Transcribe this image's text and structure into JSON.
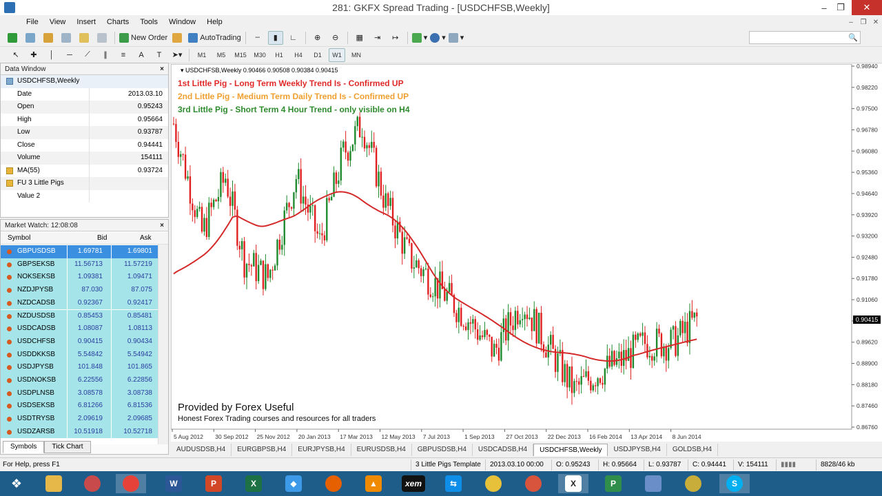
{
  "window": {
    "title": "281: GKFX Spread Trading - [USDCHFSB,Weekly]"
  },
  "menu": [
    "File",
    "View",
    "Insert",
    "Charts",
    "Tools",
    "Window",
    "Help"
  ],
  "toolbar": {
    "new_order": "New Order",
    "auto_trading": "AutoTrading",
    "timeframes": [
      "M1",
      "M5",
      "M15",
      "M30",
      "H1",
      "H4",
      "D1",
      "W1",
      "MN"
    ],
    "active_timeframe": "W1"
  },
  "data_window": {
    "title": "Data Window",
    "symbol": "USDCHFSB,Weekly",
    "rows": [
      {
        "label": "Date",
        "value": "2013.03.10"
      },
      {
        "label": "Open",
        "value": "0.95243"
      },
      {
        "label": "High",
        "value": "0.95664"
      },
      {
        "label": "Low",
        "value": "0.93787"
      },
      {
        "label": "Close",
        "value": "0.94441"
      },
      {
        "label": "Volume",
        "value": "154111"
      },
      {
        "label": "MA(55)",
        "value": "0.93724"
      },
      {
        "label": "FU 3 Little Pigs",
        "value": ""
      },
      {
        "label": "Value 2",
        "value": ""
      }
    ]
  },
  "market_watch": {
    "title": "Market Watch: 12:08:08",
    "columns": {
      "symbol": "Symbol",
      "bid": "Bid",
      "ask": "Ask"
    },
    "rows": [
      {
        "symbol": "GBPUSDSB",
        "bid": "1.69781",
        "ask": "1.69801"
      },
      {
        "symbol": "GBPSEKSB",
        "bid": "11.56713",
        "ask": "11.57219"
      },
      {
        "symbol": "NOKSEKSB",
        "bid": "1.09381",
        "ask": "1.09471"
      },
      {
        "symbol": "NZDJPYSB",
        "bid": "87.030",
        "ask": "87.075"
      },
      {
        "symbol": "NZDCADSB",
        "bid": "0.92367",
        "ask": "0.92417"
      },
      {
        "symbol": "NZDUSDSB",
        "bid": "0.85453",
        "ask": "0.85481"
      },
      {
        "symbol": "USDCADSB",
        "bid": "1.08087",
        "ask": "1.08113"
      },
      {
        "symbol": "USDCHFSB",
        "bid": "0.90415",
        "ask": "0.90434"
      },
      {
        "symbol": "USDDKKSB",
        "bid": "5.54842",
        "ask": "5.54942"
      },
      {
        "symbol": "USDJPYSB",
        "bid": "101.848",
        "ask": "101.865"
      },
      {
        "symbol": "USDNOKSB",
        "bid": "6.22556",
        "ask": "6.22856"
      },
      {
        "symbol": "USDPLNSB",
        "bid": "3.08578",
        "ask": "3.08738"
      },
      {
        "symbol": "USDSEKSB",
        "bid": "6.81266",
        "ask": "6.81536"
      },
      {
        "symbol": "USDTRYSB",
        "bid": "2.09619",
        "ask": "2.09685"
      },
      {
        "symbol": "USDZARSB",
        "bid": "10.51918",
        "ask": "10.52718"
      }
    ],
    "tabs": [
      "Symbols",
      "Tick Chart"
    ]
  },
  "chart": {
    "info": "USDCHFSB,Weekly  0.90466 0.90508 0.90384 0.90415",
    "pig1": "1st Little Pig - Long Term Weekly Trend Is - Confirmed UP",
    "pig2": "2nd Little Pig - Medium Term Daily Trend Is - Confirmed UP",
    "pig3": "3rd Little Pig - Short Term 4 Hour Trend - only visible on H4",
    "provided": "Provided by Forex Useful",
    "honest": "Honest Forex Trading courses and resources for all traders",
    "current_price": "0.90415",
    "price_ticks": [
      "0.98940",
      "0.98220",
      "0.97500",
      "0.96780",
      "0.96080",
      "0.95360",
      "0.94640",
      "0.93920",
      "0.93200",
      "0.92480",
      "0.91780",
      "0.91060",
      "0.90340",
      "0.89620",
      "0.88900",
      "0.88180",
      "0.87460",
      "0.86760"
    ],
    "date_ticks": [
      "5 Aug 2012",
      "30 Sep 2012",
      "25 Nov 2012",
      "20 Jan 2013",
      "17 Mar 2013",
      "12 May 2013",
      "7 Jul 2013",
      "1 Sep 2013",
      "27 Oct 2013",
      "22 Dec 2013",
      "16 Feb 2014",
      "13 Apr 2014",
      "8 Jun 2014"
    ],
    "colors": {
      "up": "#1f8a2e",
      "down": "#e02020",
      "ma": "#d42a2a",
      "pig1": "#e02a2a",
      "pig2": "#f0a030",
      "pig3": "#2e8b2e"
    }
  },
  "chart_tabs": [
    "AUDUSDSB,H4",
    "EURGBPSB,H4",
    "EURJPYSB,H4",
    "EURUSDSB,H4",
    "GBPUSDSB,H4",
    "USDCADSB,H4",
    "USDCHFSB,Weekly",
    "USDJPYSB,H4",
    "GOLDSB,H4"
  ],
  "active_chart_tab": "USDCHFSB,Weekly",
  "status": {
    "help": "For Help, press F1",
    "template": "3 Little Pigs Template",
    "datetime": "2013.03.10 00:00",
    "open": "O: 0.95243",
    "high": "H: 0.95664",
    "low": "L: 0.93787",
    "close": "C: 0.94441",
    "volume": "V: 154111",
    "traffic": "8828/46 kb"
  },
  "taskbar": [
    "start-icon",
    "explorer-icon",
    "paint-icon",
    "chrome-icon",
    "word-icon",
    "powerpoint-icon",
    "excel-icon",
    "dropbox-icon",
    "firefox-icon",
    "vlc-icon",
    "xem-icon",
    "teamviewer-icon",
    "audio-icon",
    "chrome2-icon",
    "xtrade-icon",
    "pdf-icon",
    "network-icon",
    "chrome3-icon",
    "skype-icon"
  ],
  "taskbar_xem": "xem"
}
